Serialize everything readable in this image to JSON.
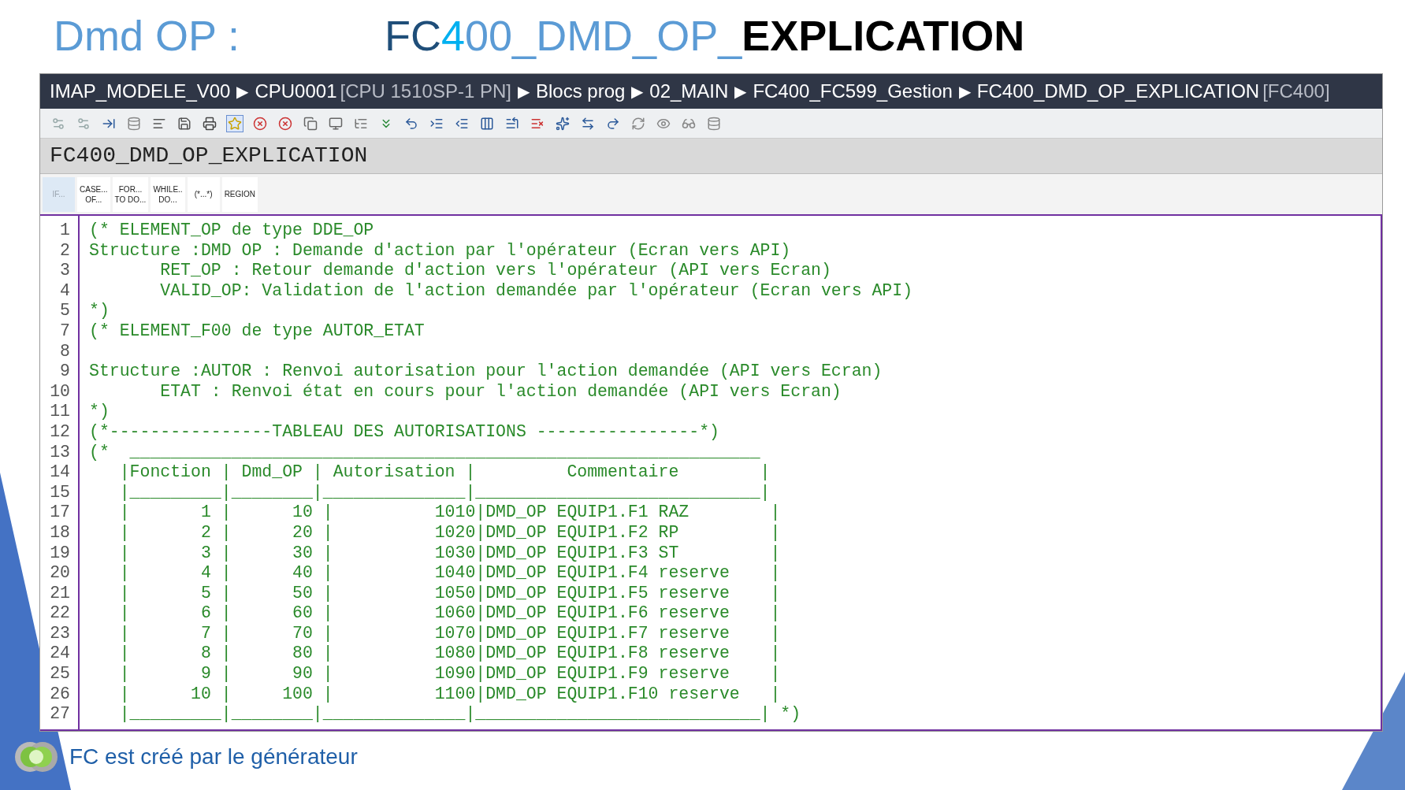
{
  "slide": {
    "heading": "Dmd OP :",
    "title_segments": [
      {
        "text": "FC",
        "color": "#1f4e79",
        "bold": false
      },
      {
        "text": "4",
        "color": "#00b0f0",
        "bold": false
      },
      {
        "text": "00_DMD_OP_",
        "color": "#5b9bd5",
        "bold": false
      },
      {
        "text": "EXPLICATION",
        "color": "#000000",
        "bold": true
      }
    ],
    "footer": "FC est créé par le générateur"
  },
  "breadcrumb": [
    {
      "label": "IMAP_MODELE_V00"
    },
    {
      "separator": "▶",
      "label": "CPU0001",
      "detail": "[CPU 1510SP-1 PN]"
    },
    {
      "separator": "▶",
      "label": "Blocs prog"
    },
    {
      "separator": "▶",
      "label": "02_MAIN"
    },
    {
      "separator": "▶",
      "label": "FC400_FC599_Gestion"
    },
    {
      "separator": "▶",
      "label": "FC400_DMD_OP_EXPLICATION",
      "detail": "[FC400]"
    }
  ],
  "block_title": "FC400_DMD_OP_EXPLICATION",
  "snippets": [
    {
      "lines": [
        "IF..."
      ],
      "disabled": true
    },
    {
      "lines": [
        "CASE...",
        "OF..."
      ],
      "disabled": false
    },
    {
      "lines": [
        "FOR...",
        "TO DO..."
      ],
      "disabled": false
    },
    {
      "lines": [
        "WHILE..",
        "DO..."
      ],
      "disabled": false
    },
    {
      "lines": [
        "(*...*)"
      ],
      "disabled": false
    },
    {
      "lines": [
        "REGION"
      ],
      "disabled": false
    }
  ],
  "code_lines": [
    {
      "number": "1",
      "text": "(* ELEMENT_OP de type DDE_OP"
    },
    {
      "number": "2",
      "text": "Structure :DMD OP : Demande d'action par l'opérateur (Ecran vers API)"
    },
    {
      "number": "3",
      "text": "       RET_OP : Retour demande d'action vers l'opérateur (API vers Ecran)"
    },
    {
      "number": "4",
      "text": "       VALID_OP: Validation de l'action demandée par l'opérateur (Ecran vers API)"
    },
    {
      "number": "5",
      "text": "*)"
    },
    {
      "number": "7",
      "text": "(* ELEMENT_F00 de type AUTOR_ETAT"
    },
    {
      "number": "8"
    },
    {
      "number": "9",
      "text": "Structure :AUTOR : Renvoi autorisation pour l'action demandée (API vers Ecran)"
    },
    {
      "number": "10",
      "text": "       ETAT : Renvoi état en cours pour l'action demandée (API vers Ecran)"
    },
    {
      "number": "11",
      "text": "*)"
    },
    {
      "number": "12",
      "text": "(*----------------TABLEAU DES AUTORISATIONS ----------------*)"
    },
    {
      "number": "13",
      "text": "(*  ______________________________________________________________"
    },
    {
      "number": "14",
      "text": "   |Fonction | Dmd_OP | Autorisation |         Commentaire        |"
    },
    {
      "number": "15",
      "text": "   |_________|________|______________|____________________________|"
    },
    {
      "number": "17",
      "text": "   |       1 |      10 |          1010|DMD_OP EQUIP1.F1 RAZ        |"
    },
    {
      "number": "18",
      "text": "   |       2 |      20 |          1020|DMD_OP EQUIP1.F2 RP         |"
    },
    {
      "number": "19",
      "text": "   |       3 |      30 |          1030|DMD_OP EQUIP1.F3 ST         |"
    },
    {
      "number": "20",
      "text": "   |       4 |      40 |          1040|DMD_OP EQUIP1.F4 reserve    |"
    },
    {
      "number": "21",
      "text": "   |       5 |      50 |          1050|DMD_OP EQUIP1.F5 reserve    |"
    },
    {
      "number": "22",
      "text": "   |       6 |      60 |          1060|DMD_OP EQUIP1.F6 reserve    |"
    },
    {
      "number": "23",
      "text": "   |       7 |      70 |          1070|DMD_OP EQUIP1.F7 reserve    |"
    },
    {
      "number": "24",
      "text": "   |       8 |      80 |          1080|DMD_OP EQUIP1.F8 reserve    |"
    },
    {
      "number": "25",
      "text": "   |       9 |      90 |          1090|DMD_OP EQUIP1.F9 reserve    |"
    },
    {
      "number": "26",
      "text": "   |      10 |     100 |          1100|DMD_OP EQUIP1.F10 reserve   |"
    },
    {
      "number": "27",
      "text": "   |_________|________|______________|____________________________| *)"
    }
  ]
}
